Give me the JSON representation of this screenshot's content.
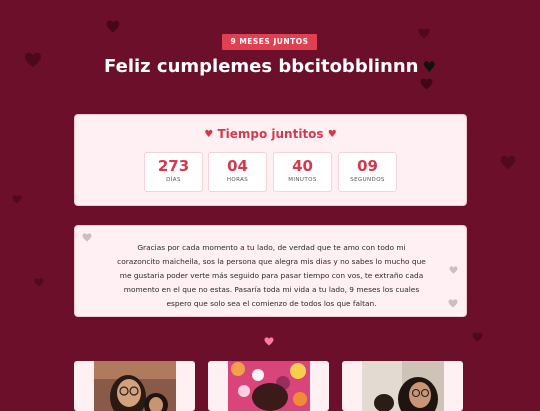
{
  "header": {
    "badge": "9 MESES JUNTOS",
    "title": "Feliz cumplemes bbcitobblinnn",
    "title_heart": "♥"
  },
  "timer": {
    "heart_left": "♥",
    "heading": "Tiempo juntitos",
    "heart_right": "♥",
    "units": [
      {
        "value": "273",
        "label": "DÍAS"
      },
      {
        "value": "04",
        "label": "HORAS"
      },
      {
        "value": "40",
        "label": "MINUTOS"
      },
      {
        "value": "09",
        "label": "SEGUNDOS"
      }
    ]
  },
  "message": {
    "text": "Gracias por cada momento a tu lado, de verdad que te amo con todo mi corazoncito maicheila, sos la persona que alegra mis dias y no sabes lo mucho que me gustaria poder verte más seguido para pasar tiempo con vos, te extraño cada momento en el que no estas. Pasaría toda mi vida a tu lado, 9 meses los cuales espero que solo sea el comienzo de todos los que faltan."
  },
  "colors": {
    "background": "#6b0f2a",
    "accent": "#e04152",
    "number": "#d23a4f",
    "card": "#fff0f3"
  },
  "icons": [
    "heart-icon",
    "photo"
  ]
}
